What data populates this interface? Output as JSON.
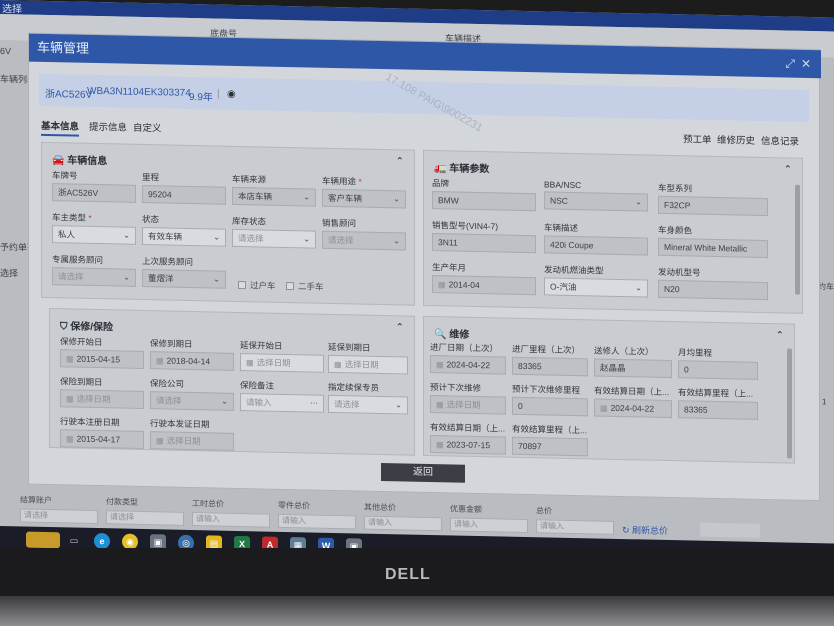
{
  "background": {
    "top_title": "选择",
    "header_cols": [
      "底盘号",
      "车辆描述"
    ],
    "left_items": [
      "6V",
      "车辆列表",
      "予约单列",
      "选择"
    ],
    "right_items": [
      "下",
      "预约车",
      "1"
    ],
    "bottom_fields": [
      {
        "label": "结算账户",
        "placeholder": "请选择"
      },
      {
        "label": "付款类型",
        "placeholder": "请选择"
      },
      {
        "label": "工时总价",
        "placeholder": "请输入"
      },
      {
        "label": "零件总价",
        "placeholder": "请输入"
      },
      {
        "label": "其他总价",
        "placeholder": "请输入"
      },
      {
        "label": "优惠金额",
        "placeholder": "请输入"
      },
      {
        "label": "总价",
        "placeholder": "请输入"
      }
    ],
    "refresh_total_label": "刷新总价"
  },
  "modal": {
    "title": "车辆管理",
    "vehicle_summary": {
      "plate": "浙AC526V",
      "vin": "WBA3N1104EK303374",
      "years": "9.9年"
    },
    "watermark": "17.108 PAIG\\9002231",
    "tabs": [
      "基本信息",
      "提示信息",
      "自定义"
    ],
    "actions": [
      "预工单",
      "维修历史",
      "信息记录"
    ],
    "return_label": "返回",
    "vehicle_info": {
      "title": "车辆信息",
      "fields": [
        {
          "label": "车牌号",
          "value": "浙AC526V"
        },
        {
          "label": "里程",
          "value": "95204"
        },
        {
          "label": "车辆来源",
          "value": "本店车辆"
        },
        {
          "label": "车辆用途",
          "value": "客户车辆",
          "required": "*"
        },
        {
          "label": "车主类型",
          "value": "私人",
          "required": "*"
        },
        {
          "label": "状态",
          "value": "有效车辆"
        },
        {
          "label": "库存状态",
          "value": "请选择"
        },
        {
          "label": "销售顾问",
          "value": "请选择"
        },
        {
          "label": "专属服务顾问",
          "value": "请选择"
        },
        {
          "label": "上次服务顾问",
          "value": "董熠洋"
        }
      ],
      "checkboxes": [
        "过户车",
        "二手车"
      ]
    },
    "vehicle_params": {
      "title": "车辆参数",
      "fields": [
        {
          "label": "品牌",
          "value": "BMW"
        },
        {
          "label": "BBA/NSC",
          "value": "NSC"
        },
        {
          "label": "车型系列",
          "value": "F32CP"
        },
        {
          "label": "销售型号(VIN4-7)",
          "value": "3N11"
        },
        {
          "label": "车辆描述",
          "value": "420i Coupe"
        },
        {
          "label": "车身颜色",
          "value": "Mineral White Metallic"
        },
        {
          "label": "生产年月",
          "value": "2014-04"
        },
        {
          "label": "发动机燃油类型",
          "value": "O-汽油"
        },
        {
          "label": "发动机型号",
          "value": "N20"
        }
      ]
    },
    "warranty": {
      "title": "保修/保险",
      "fields": [
        {
          "label": "保修开始日",
          "value": "2015-04-15"
        },
        {
          "label": "保修到期日",
          "value": "2018-04-14"
        },
        {
          "label": "延保开始日",
          "value": "选择日期"
        },
        {
          "label": "延保到期日",
          "value": "选择日期"
        },
        {
          "label": "保险到期日",
          "value": "选择日期"
        },
        {
          "label": "保险公司",
          "value": "请选择"
        },
        {
          "label": "保险备注",
          "value": "请输入"
        },
        {
          "label": "指定续保专员",
          "value": "请选择"
        },
        {
          "label": "行驶本注册日期",
          "value": "2015-04-17"
        },
        {
          "label": "行驶本发证日期",
          "value": "选择日期"
        }
      ]
    },
    "maintenance": {
      "title": "维修",
      "fields": [
        {
          "label": "进厂日期（上次）",
          "value": "2024-04-22"
        },
        {
          "label": "进厂里程（上次）",
          "value": "83365"
        },
        {
          "label": "送修人（上次）",
          "value": "赵晶晶"
        },
        {
          "label": "月均里程",
          "value": "0"
        },
        {
          "label": "预计下次维修",
          "value": "选择日期"
        },
        {
          "label": "预计下次维修里程",
          "value": "0"
        },
        {
          "label": "有效结算日期（上...",
          "value": "2024-04-22"
        },
        {
          "label": "有效结算里程（上...",
          "value": "83365"
        },
        {
          "label": "有效结算日期（上...",
          "value": "2023-07-15"
        },
        {
          "label": "有效结算里程（上...",
          "value": "70897"
        }
      ]
    }
  },
  "monitor_brand": "DELL"
}
